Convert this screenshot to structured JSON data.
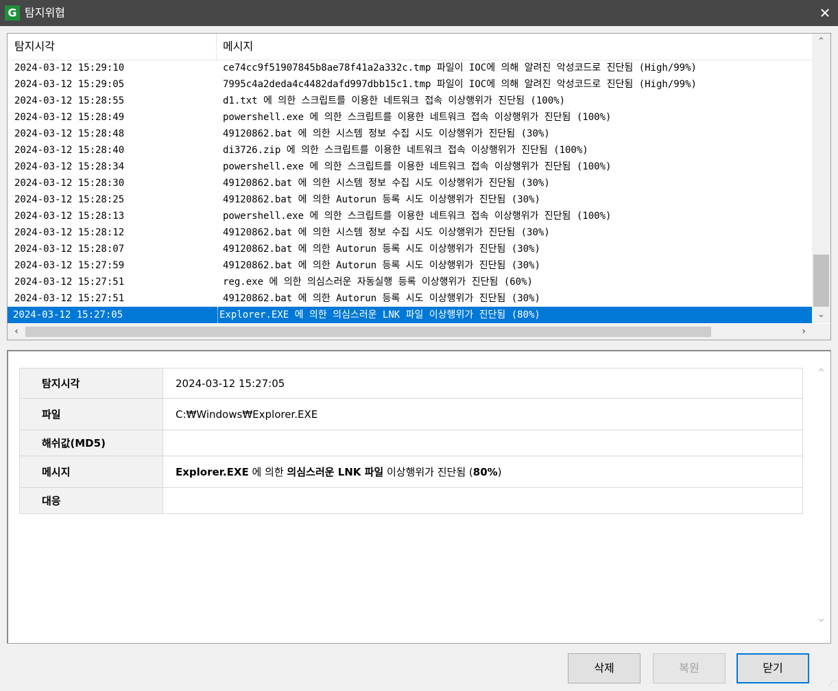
{
  "window": {
    "title": "탐지위협",
    "logo": "G",
    "close_icon": "✕"
  },
  "list": {
    "columns": [
      "탐지시각",
      "메시지"
    ],
    "rows": [
      [
        "2024-03-12 15:29:10",
        "ce74cc9f51907845b8ae78f41a2a332c.tmp 파일이 IOC에 의해 알려진 악성코드로 진단됨 (High/99%)"
      ],
      [
        "2024-03-12 15:29:05",
        "7995c4a2deda4c4482dafd997dbb15c1.tmp 파일이 IOC에 의해 알려진 악성코드로 진단됨 (High/99%)"
      ],
      [
        "2024-03-12 15:28:55",
        "d1.txt 에 의한 스크립트를 이용한 네트워크 접속 이상행위가 진단됨 (100%)"
      ],
      [
        "2024-03-12 15:28:49",
        "powershell.exe 에 의한 스크립트를 이용한 네트워크 접속 이상행위가 진단됨 (100%)"
      ],
      [
        "2024-03-12 15:28:48",
        "49120862.bat 에 의한 시스템 정보 수집 시도 이상행위가 진단됨 (30%)"
      ],
      [
        "2024-03-12 15:28:40",
        "di3726.zip 에 의한 스크립트를 이용한 네트워크 접속 이상행위가 진단됨 (100%)"
      ],
      [
        "2024-03-12 15:28:34",
        "powershell.exe 에 의한 스크립트를 이용한 네트워크 접속 이상행위가 진단됨 (100%)"
      ],
      [
        "2024-03-12 15:28:30",
        "49120862.bat 에 의한 시스템 정보 수집 시도 이상행위가 진단됨 (30%)"
      ],
      [
        "2024-03-12 15:28:25",
        "49120862.bat 에 의한 Autorun 등록 시도 이상행위가 진단됨 (30%)"
      ],
      [
        "2024-03-12 15:28:13",
        "powershell.exe 에 의한 스크립트를 이용한 네트워크 접속 이상행위가 진단됨 (100%)"
      ],
      [
        "2024-03-12 15:28:12",
        "49120862.bat 에 의한 시스템 정보 수집 시도 이상행위가 진단됨 (30%)"
      ],
      [
        "2024-03-12 15:28:07",
        "49120862.bat 에 의한 Autorun 등록 시도 이상행위가 진단됨 (30%)"
      ],
      [
        "2024-03-12 15:27:59",
        "49120862.bat 에 의한 Autorun 등록 시도 이상행위가 진단됨 (30%)"
      ],
      [
        "2024-03-12 15:27:51",
        "reg.exe 에 의한 의심스러운 자동실행 등록 이상행위가 진단됨 (60%)"
      ],
      [
        "2024-03-12 15:27:51",
        "49120862.bat 에 의한 Autorun 등록 시도 이상행위가 진단됨 (30%)"
      ],
      [
        "2024-03-12 15:27:05",
        "Explorer.EXE 에 의한 의심스러운 LNK 파일 이상행위가 진단됨 (80%)"
      ]
    ],
    "selected_index": 15,
    "icons": {
      "scroll_up": "chevron-up-icon",
      "scroll_down": "chevron-down-icon",
      "scroll_left": "chevron-left-icon",
      "scroll_right": "chevron-right-icon"
    }
  },
  "detail": {
    "labels": {
      "time": "탐지시각",
      "file": "파일",
      "hash": "해쉬값(MD5)",
      "message": "메시지",
      "response": "대응"
    },
    "time": "2024-03-12 15:27:05",
    "file": "C:₩Windows₩Explorer.EXE",
    "hash": "",
    "message_parts": {
      "subject": "Explorer.EXE",
      "part1": " 에 의한 ",
      "behavior": "의심스러운 LNK 파일",
      "part2": " 이상행위가 진단됨 (",
      "percent": "80%",
      "part3": ")"
    },
    "response": ""
  },
  "buttons": {
    "delete": "삭제",
    "restore": "복원",
    "close": "닫기"
  },
  "colors": {
    "selection": "#0078d7",
    "titlebar": "#474747",
    "logo": "#1f8f3e"
  }
}
